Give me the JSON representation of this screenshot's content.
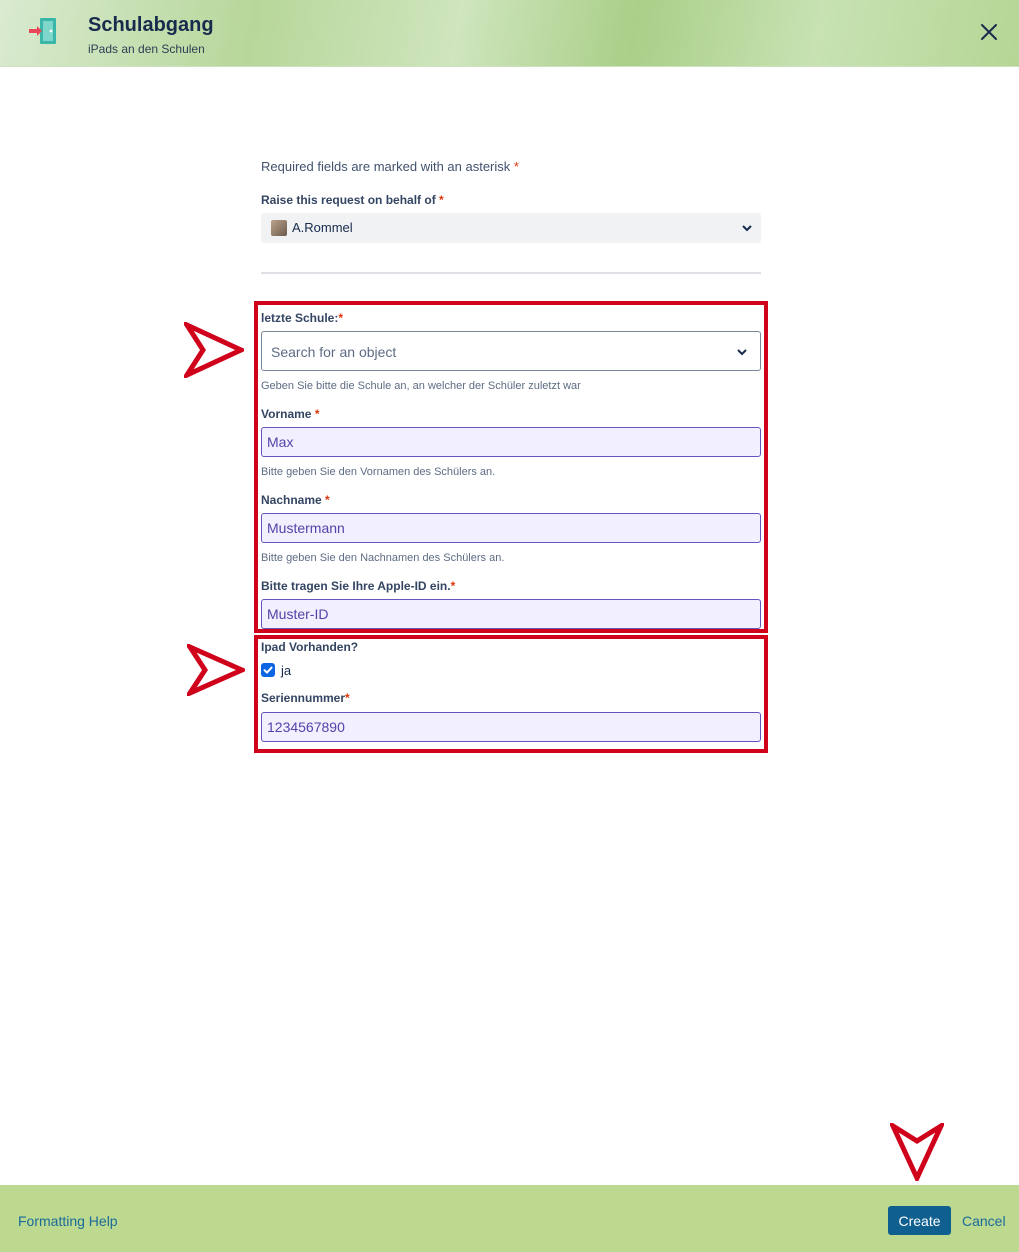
{
  "header": {
    "title": "Schulabgang",
    "subtitle": "iPads an den Schulen"
  },
  "form": {
    "required_note": "Required fields are marked with an asterisk",
    "required_star": "*",
    "behalf": {
      "label": "Raise this request on behalf of",
      "star": "*",
      "value": "A.Rommel"
    },
    "school": {
      "label": "letzte Schule:",
      "star": "*",
      "placeholder": "Search for an object",
      "help": "Geben Sie bitte die Schule an, an welcher der Schüler zuletzt war"
    },
    "firstname": {
      "label": "Vorname",
      "star": "*",
      "value": "Max",
      "help": "Bitte geben Sie den Vornamen des Schülers an."
    },
    "lastname": {
      "label": "Nachname",
      "star": "*",
      "value": "Mustermann",
      "help": "Bitte geben Sie den Nachnamen des Schülers an."
    },
    "apple_id": {
      "label": "Bitte tragen Sie Ihre Apple-ID ein.",
      "star": "*",
      "value": "Muster-ID"
    },
    "ipad": {
      "label": "Ipad Vorhanden?",
      "option_label": "ja",
      "checked": true
    },
    "serial": {
      "label": "Seriennummer",
      "star": "*",
      "value": "1234567890"
    }
  },
  "footer": {
    "formatting_help": "Formatting Help",
    "create_label": "Create",
    "cancel_label": "Cancel"
  },
  "colors": {
    "header_green": "#b7d79a",
    "footer_green": "#bcd98f",
    "highlight_red": "#d0021b",
    "primary_button": "#0f5f8f",
    "input_fill": "#f2efff",
    "input_border": "#6554c0"
  },
  "icons": {
    "header": "door-exit-icon",
    "close": "close-icon",
    "chevron": "chevron-down-icon",
    "check": "checkmark-icon",
    "annotation": "arrow-pointer-icon"
  }
}
